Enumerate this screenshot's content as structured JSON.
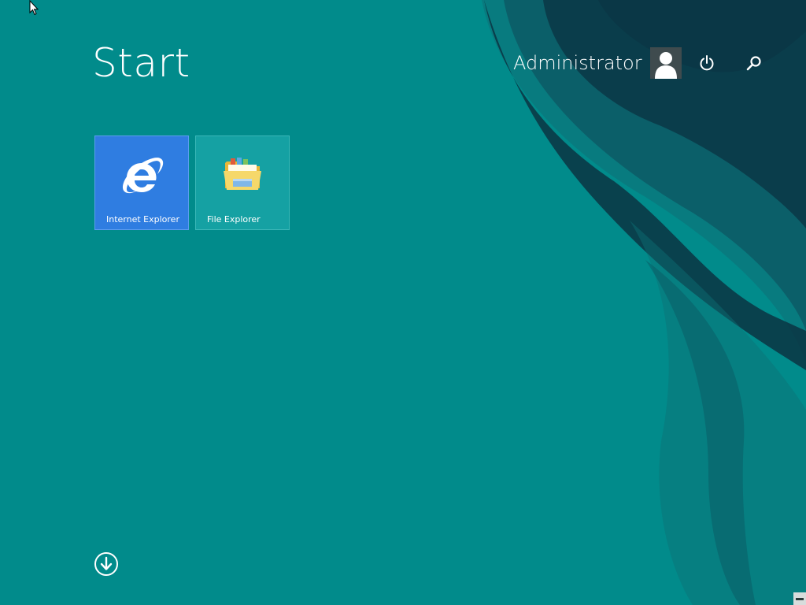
{
  "start": {
    "title": "Start"
  },
  "user": {
    "name": "Administrator"
  },
  "tiles": [
    {
      "label": "Internet Explorer",
      "icon": "internet-explorer-icon",
      "color": "#2f7de1"
    },
    {
      "label": "File Explorer",
      "icon": "file-explorer-icon",
      "color": "#15a1a3"
    }
  ],
  "icons": {
    "power": "power-icon",
    "search": "search-icon",
    "apps": "arrow-down-circle-icon"
  },
  "colors": {
    "background": "#018b8b",
    "swirl_dark": "#0b3d4a",
    "swirl_mid": "#0e5f69"
  }
}
